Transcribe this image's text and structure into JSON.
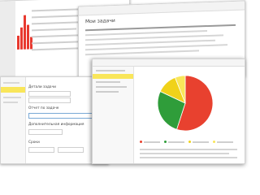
{
  "dashboard_window": {
    "bars": [
      0.35,
      0.55,
      0.85,
      0.6,
      0.3
    ]
  },
  "tasks_window": {
    "title": "Мои задачи"
  },
  "task_form": {
    "sections": [
      "Детали задачи",
      "Отчет по задаче",
      "Дополнительная информация",
      "Сроки"
    ]
  },
  "report_window": {
    "chart_data": {
      "type": "pie",
      "slices": [
        {
          "value": 55,
          "color": "#e8412f"
        },
        {
          "value": 27,
          "color": "#2f9d3a"
        },
        {
          "value": 12,
          "color": "#f0d21a"
        },
        {
          "value": 6,
          "color": "#f9e65a"
        }
      ]
    }
  },
  "colors": {
    "accent_yellow": "#f9e65a",
    "red": "#e8392f",
    "green": "#2f9d3a"
  }
}
